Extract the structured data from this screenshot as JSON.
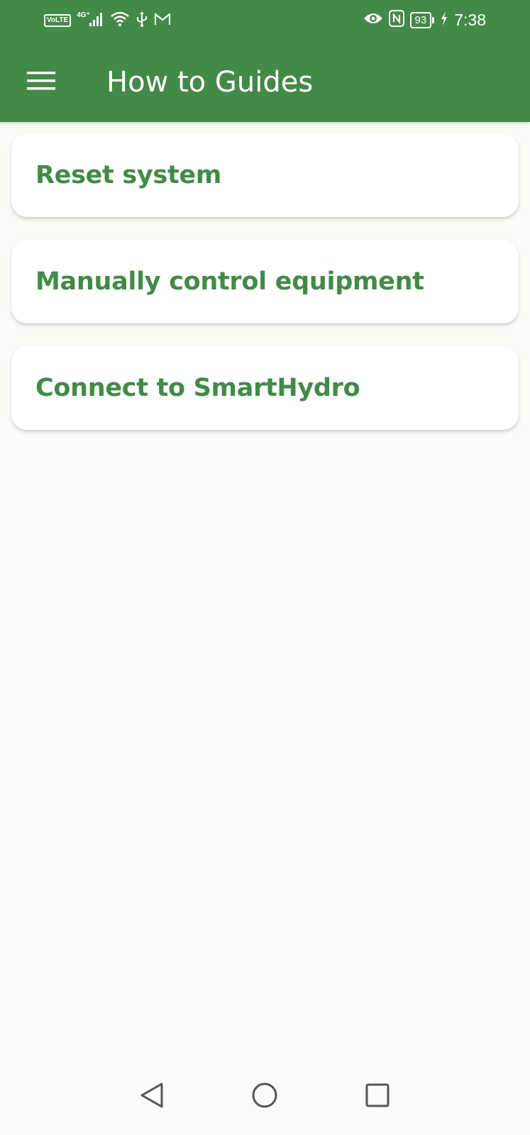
{
  "status_bar": {
    "volte": "VoLTE",
    "network": "4G⁺",
    "battery": "93",
    "time": "7:38",
    "icons": [
      "volte-icon",
      "signal-icon",
      "wifi-icon",
      "usb-icon",
      "gmail-icon",
      "eye-icon",
      "nfc-icon",
      "battery-icon",
      "charging-icon"
    ]
  },
  "app_bar": {
    "title": "How to Guides",
    "menu_icon": "hamburger-menu-icon",
    "background": "#438a48"
  },
  "guides": [
    {
      "label": "Reset system"
    },
    {
      "label": "Manually control equipment"
    },
    {
      "label": "Connect to SmartHydro"
    }
  ],
  "colors": {
    "primary": "#438a48",
    "background": "#fcfbf8",
    "card": "#ffffff"
  },
  "nav_bar": {
    "buttons": [
      "back-icon",
      "home-icon",
      "recents-icon"
    ]
  }
}
